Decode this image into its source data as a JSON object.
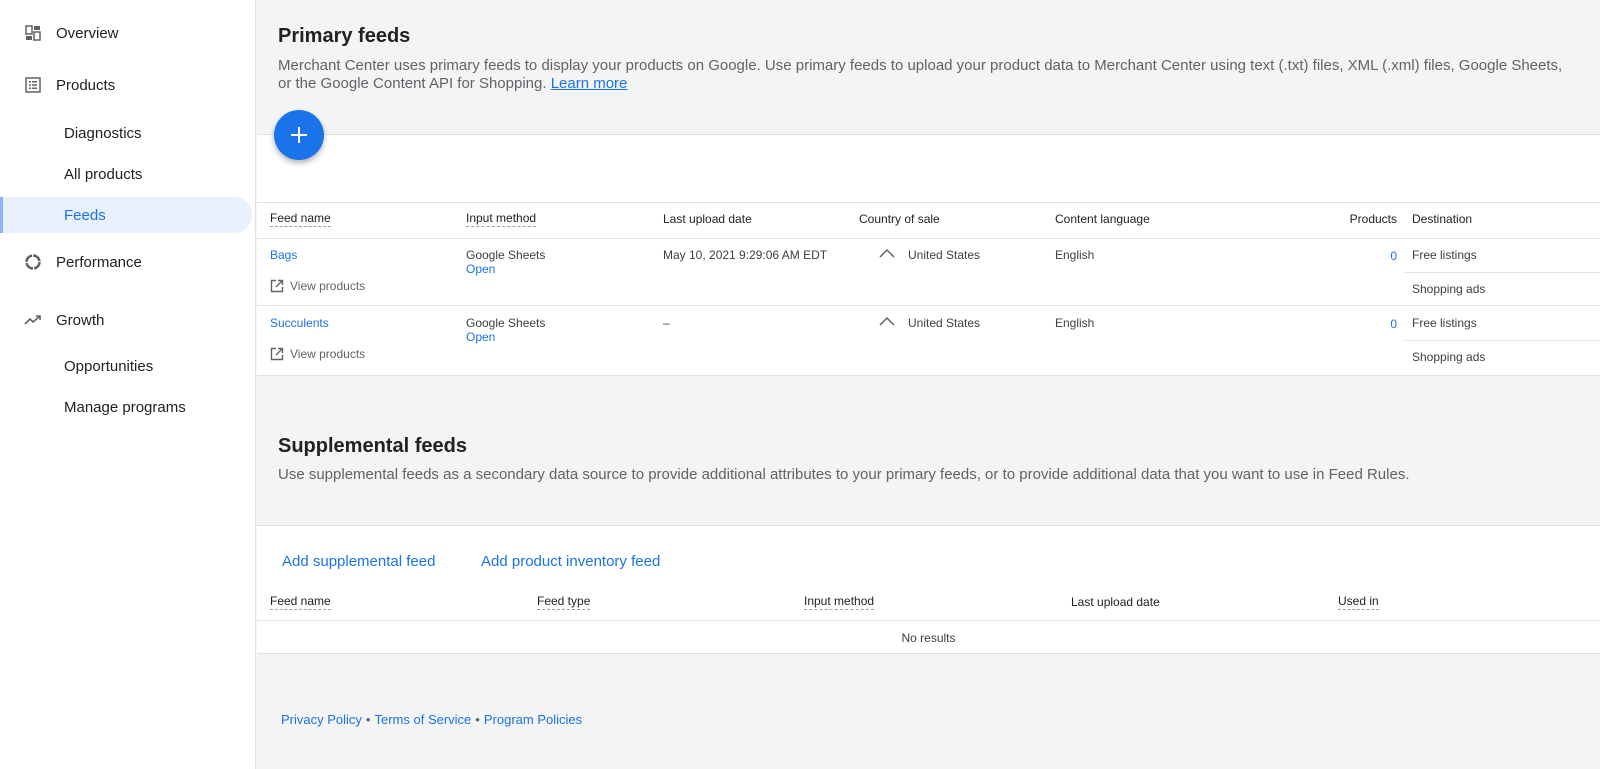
{
  "sidebar": {
    "items": [
      {
        "label": "Overview",
        "icon": "dashboard-icon"
      },
      {
        "label": "Products",
        "icon": "list-icon"
      },
      {
        "label": "Diagnostics"
      },
      {
        "label": "All products"
      },
      {
        "label": "Feeds",
        "active": true
      },
      {
        "label": "Performance",
        "icon": "performance-icon"
      },
      {
        "label": "Growth",
        "icon": "trending-up-icon"
      },
      {
        "label": "Opportunities"
      },
      {
        "label": "Manage programs"
      }
    ]
  },
  "primary": {
    "title": "Primary feeds",
    "description": "Merchant Center uses primary feeds to display your products on Google. Use primary feeds to upload your product data to Merchant Center using text (.txt) files, XML (.xml) files, Google Sheets, or the Google Content API for Shopping.",
    "learn_more": "Learn more",
    "add_button_icon": "plus-icon",
    "columns": [
      "Feed name",
      "Input method",
      "Last upload date",
      "Country of sale",
      "Content language",
      "Products",
      "Destination"
    ],
    "rows": [
      {
        "name": "Bags",
        "view_products": "View products",
        "input_method": "Google Sheets",
        "input_action": "Open",
        "last_upload": "May 10, 2021 9:29:06 AM EDT",
        "country": "United States",
        "language": "English",
        "products": "0",
        "destinations": [
          "Free listings",
          "Shopping ads"
        ]
      },
      {
        "name": "Succulents",
        "view_products": "View products",
        "input_method": "Google Sheets",
        "input_action": "Open",
        "last_upload": "–",
        "country": "United States",
        "language": "English",
        "products": "0",
        "destinations": [
          "Free listings",
          "Shopping ads"
        ]
      }
    ]
  },
  "supplemental": {
    "title": "Supplemental feeds",
    "description": "Use supplemental feeds as a secondary data source to provide additional attributes to your primary feeds, or to provide additional data that you want to use in Feed Rules.",
    "add_supplemental": "Add supplemental feed",
    "add_inventory": "Add product inventory feed",
    "columns": [
      "Feed name",
      "Feed type",
      "Input method",
      "Last upload date",
      "Used in"
    ],
    "empty": "No results"
  },
  "footer": {
    "links": [
      "Privacy Policy",
      "Terms of Service",
      "Program Policies"
    ],
    "separator": "•"
  },
  "colors": {
    "accent": "#1a73e8",
    "active_bg": "#e8f0fe"
  }
}
